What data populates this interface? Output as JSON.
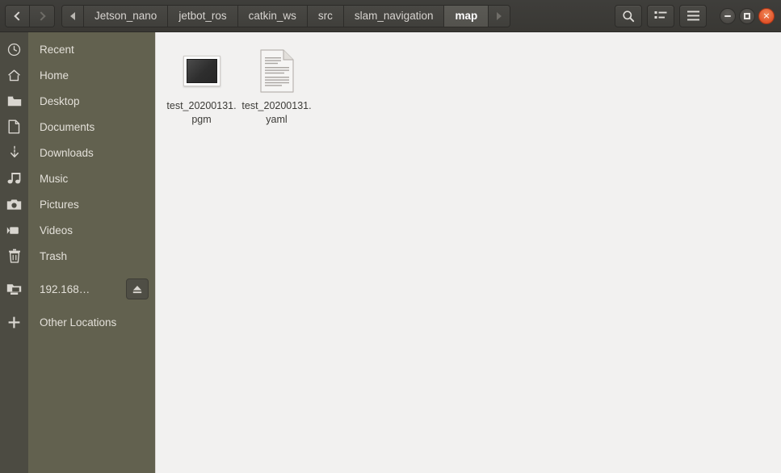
{
  "window": {
    "app": "Files",
    "controls": {
      "minimize_label": "Minimize",
      "maximize_label": "Maximize",
      "close_label": "×"
    }
  },
  "headerbar": {
    "nav": {
      "back_label": "Back",
      "forward_label": "Forward"
    },
    "path_scroll_left_label": "Scroll path left",
    "path_scroll_right_label": "Scroll path right",
    "breadcrumbs": [
      {
        "label": "Jetson_nano",
        "active": false
      },
      {
        "label": "jetbot_ros",
        "active": false
      },
      {
        "label": "catkin_ws",
        "active": false
      },
      {
        "label": "src",
        "active": false
      },
      {
        "label": "slam_navigation",
        "active": false
      },
      {
        "label": "map",
        "active": true
      }
    ],
    "tools": [
      {
        "name": "search-icon",
        "label": "Search"
      },
      {
        "name": "view-list-icon",
        "label": "View options"
      },
      {
        "name": "hamburger-menu-icon",
        "label": "Menu"
      }
    ]
  },
  "sidebar": {
    "items": [
      {
        "label": "Recent",
        "icon": "clock-icon"
      },
      {
        "label": "Home",
        "icon": "home-icon"
      },
      {
        "label": "Desktop",
        "icon": "folder-icon"
      },
      {
        "label": "Documents",
        "icon": "document-icon"
      },
      {
        "label": "Downloads",
        "icon": "download-icon"
      },
      {
        "label": "Music",
        "icon": "music-icon"
      },
      {
        "label": "Pictures",
        "icon": "camera-icon"
      },
      {
        "label": "Videos",
        "icon": "camcorder-icon"
      },
      {
        "label": "Trash",
        "icon": "trash-icon"
      }
    ],
    "mounts": [
      {
        "label": "192.168…",
        "icon": "network-drive-icon",
        "eject": true,
        "eject_label": "Unmount"
      }
    ],
    "other": {
      "label": "Other Locations",
      "icon": "plus-icon"
    }
  },
  "main": {
    "files": [
      {
        "name": "test_20200131.pgm",
        "type": "image-thumbnail"
      },
      {
        "name": "test_20200131.yaml",
        "type": "text-document"
      }
    ]
  },
  "colors": {
    "headerbar": "#3f3e3b",
    "sidebar_labels": "#62614f",
    "sidebar_icons": "#4c4b42",
    "content_bg": "#f2f1f0",
    "close_button": "#e2542a",
    "active_crumb": "#5b5a55"
  }
}
